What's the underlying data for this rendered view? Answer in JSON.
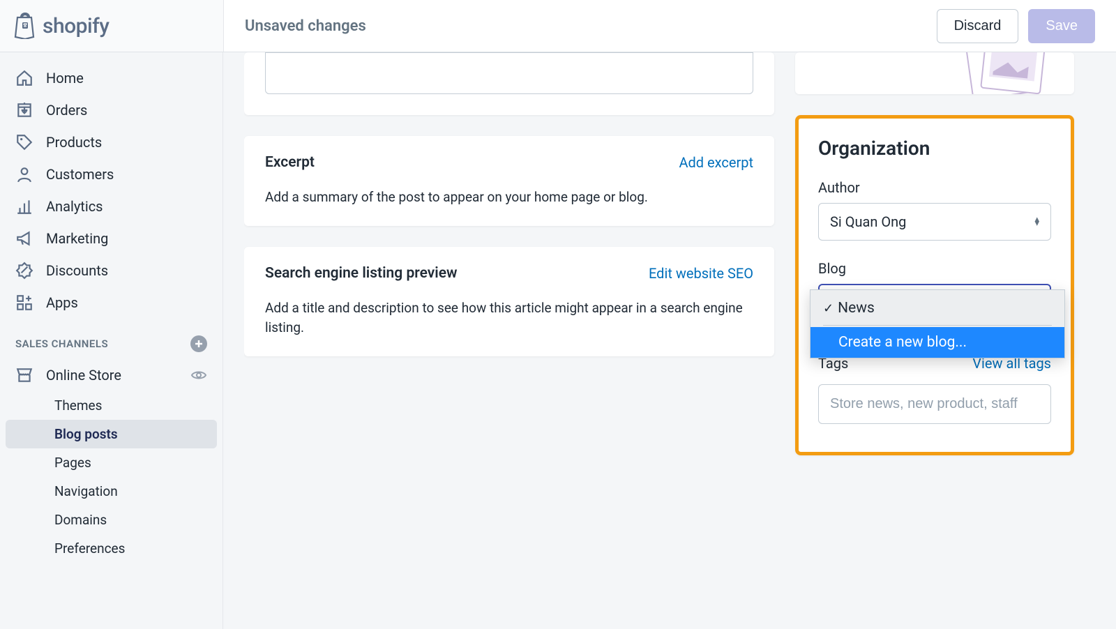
{
  "header": {
    "unsaved": "Unsaved changes",
    "discard": "Discard",
    "save": "Save",
    "brand": "shopify"
  },
  "sidebar": {
    "items": [
      {
        "icon": "home",
        "label": "Home"
      },
      {
        "icon": "orders",
        "label": "Orders"
      },
      {
        "icon": "products",
        "label": "Products"
      },
      {
        "icon": "customers",
        "label": "Customers"
      },
      {
        "icon": "analytics",
        "label": "Analytics"
      },
      {
        "icon": "marketing",
        "label": "Marketing"
      },
      {
        "icon": "discounts",
        "label": "Discounts"
      },
      {
        "icon": "apps",
        "label": "Apps"
      }
    ],
    "section_label": "SALES CHANNELS",
    "channel": {
      "label": "Online Store"
    },
    "subitems": [
      {
        "label": "Themes"
      },
      {
        "label": "Blog posts",
        "active": true
      },
      {
        "label": "Pages"
      },
      {
        "label": "Navigation"
      },
      {
        "label": "Domains"
      },
      {
        "label": "Preferences"
      }
    ]
  },
  "cards": {
    "excerpt": {
      "title": "Excerpt",
      "link": "Add excerpt",
      "desc": "Add a summary of the post to appear on your home page or blog."
    },
    "seo": {
      "title": "Search engine listing preview",
      "link": "Edit website SEO",
      "desc": "Add a title and description to see how this article might appear in a search engine listing."
    }
  },
  "organization": {
    "title": "Organization",
    "author_label": "Author",
    "author_value": "Si Quan Ong",
    "blog_label": "Blog",
    "blog_options": {
      "news": "News",
      "create": "Create a new blog..."
    },
    "tags_label": "Tags",
    "tags_link": "View all tags",
    "tags_placeholder": "Store news, new product, staff"
  }
}
